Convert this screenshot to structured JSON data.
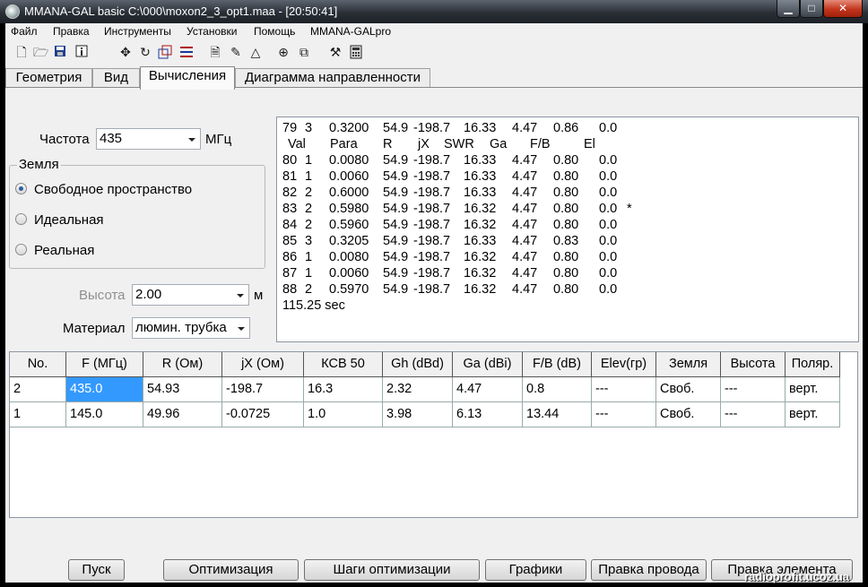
{
  "window": {
    "title": "MMANA-GAL basic C:\\000\\moxon2_3_opt1.maa - [20:50:41]",
    "min": "▁",
    "max": "□",
    "close": "✕"
  },
  "menu": [
    "Файл",
    "Правка",
    "Инструменты",
    "Установки",
    "Помощь",
    "MMANA-GALpro"
  ],
  "toolbar_icons": [
    "new-file-icon",
    "open-folder-icon",
    "save-icon",
    "info-icon",
    "move-icon",
    "rotate-icon",
    "scale-icon",
    "wires-icon",
    "document-icon",
    "pen-icon",
    "triangle-icon",
    "crosshair-icon",
    "copy-icon",
    "tools-icon",
    "calculator-icon"
  ],
  "tabs": [
    "Геометрия",
    "Вид",
    "Вычисления",
    "Диаграмма направленности"
  ],
  "active_tab": 2,
  "freq": {
    "label": "Частота",
    "value": "435",
    "unit": "МГц"
  },
  "ground": {
    "legend": "Земля",
    "options": [
      "Свободное пространство",
      "Идеальная",
      "Реальная"
    ],
    "selected": 0
  },
  "height": {
    "label": "Высота",
    "value": "2.00",
    "unit": "м"
  },
  "material": {
    "label": "Материал",
    "value": "люмин. трубка"
  },
  "output": {
    "header_top": [
      "79",
      "3",
      "0.3200",
      "54.9",
      "-198.7",
      "16.33",
      "4.47",
      "0.86",
      "0.0",
      ""
    ],
    "header": [
      "Val",
      "Para",
      "R",
      "jX",
      "SWR",
      "Ga",
      "F/B",
      "El"
    ],
    "rows": [
      [
        "80",
        "1",
        "0.0080",
        "54.9",
        "-198.7",
        "16.33",
        "4.47",
        "0.80",
        "0.0",
        ""
      ],
      [
        "81",
        "1",
        "0.0060",
        "54.9",
        "-198.7",
        "16.33",
        "4.47",
        "0.80",
        "0.0",
        ""
      ],
      [
        "82",
        "2",
        "0.6000",
        "54.9",
        "-198.7",
        "16.33",
        "4.47",
        "0.80",
        "0.0",
        ""
      ],
      [
        "83",
        "2",
        "0.5980",
        "54.9",
        "-198.7",
        "16.32",
        "4.47",
        "0.80",
        "0.0",
        "*"
      ],
      [
        "84",
        "2",
        "0.5960",
        "54.9",
        "-198.7",
        "16.32",
        "4.47",
        "0.80",
        "0.0",
        ""
      ],
      [
        "85",
        "3",
        "0.3205",
        "54.9",
        "-198.7",
        "16.33",
        "4.47",
        "0.83",
        "0.0",
        ""
      ],
      [
        "86",
        "1",
        "0.0080",
        "54.9",
        "-198.7",
        "16.32",
        "4.47",
        "0.80",
        "0.0",
        ""
      ],
      [
        "87",
        "1",
        "0.0060",
        "54.9",
        "-198.7",
        "16.32",
        "4.47",
        "0.80",
        "0.0",
        ""
      ],
      [
        "88",
        "2",
        "0.5970",
        "54.9",
        "-198.7",
        "16.32",
        "4.47",
        "0.80",
        "0.0",
        ""
      ]
    ],
    "footer": "115.25 sec"
  },
  "table": {
    "columns": [
      "No.",
      "F (МГц)",
      "R (Ом)",
      "jX (Ом)",
      "КСВ 50",
      "Gh (dBd)",
      "Ga (dBi)",
      "F/B (dB)",
      "Elev(гр)",
      "Земля",
      "Высота",
      "Поляр."
    ],
    "rows": [
      [
        "2",
        "435.0",
        "54.93",
        "-198.7",
        "16.3",
        "2.32",
        "4.47",
        "0.8",
        "---",
        "Своб.",
        "---",
        "верт."
      ],
      [
        "1",
        "145.0",
        "49.96",
        "-0.0725",
        "1.0",
        "3.98",
        "6.13",
        "13.44",
        "---",
        "Своб.",
        "---",
        "верт."
      ]
    ]
  },
  "buttons": [
    "Пуск",
    "Оптимизация",
    "Шаги оптимизации",
    "Графики",
    "Правка провода",
    "Правка элемента"
  ],
  "watermark": "radioprofit.ucoz.ua"
}
